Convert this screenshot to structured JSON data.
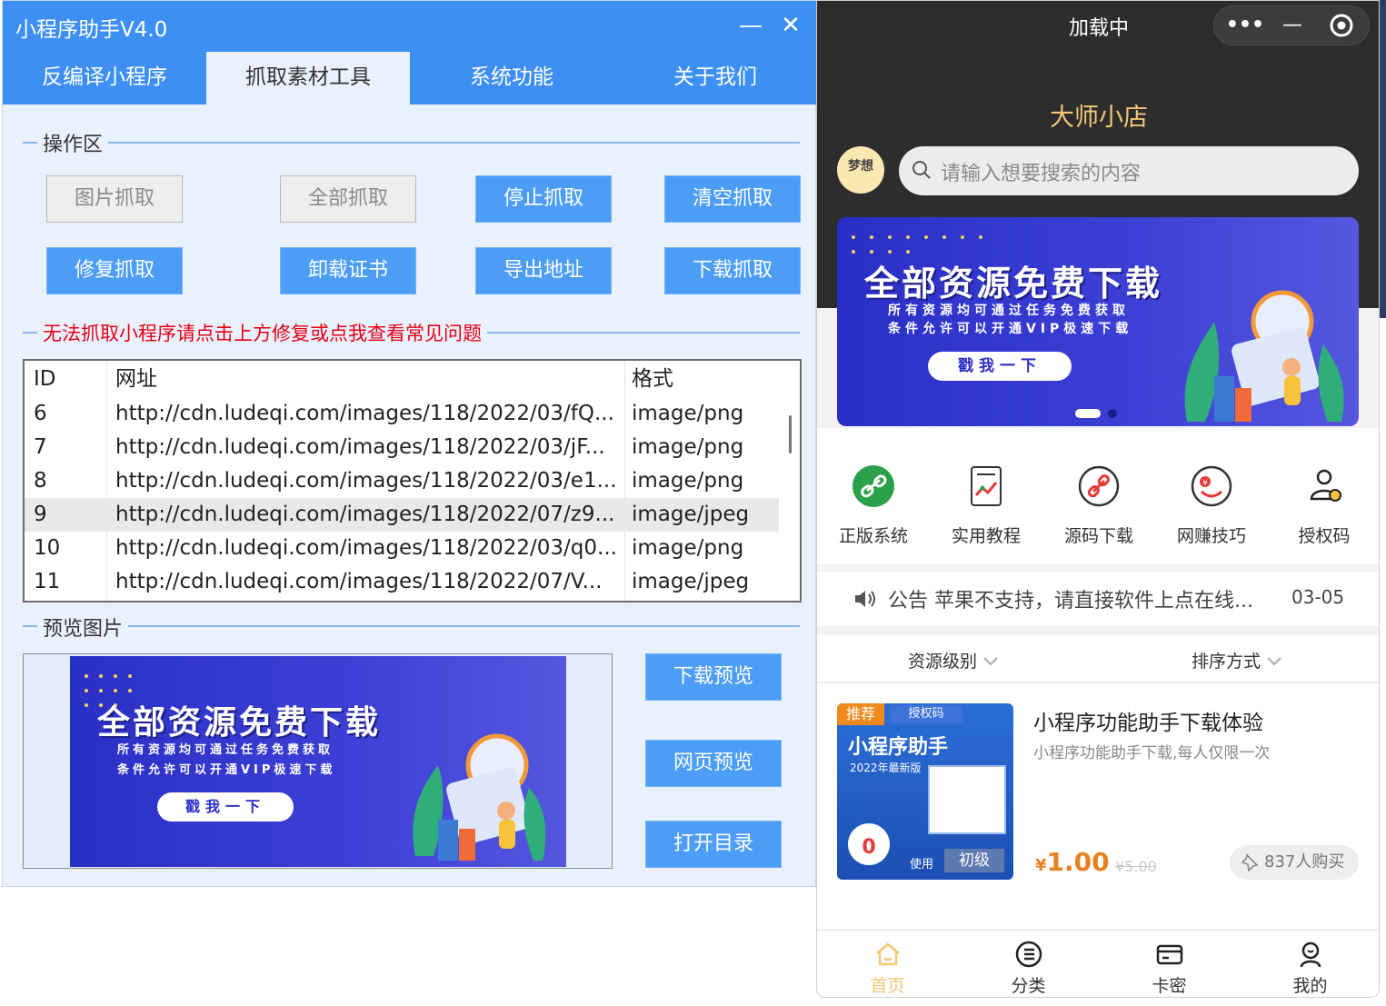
{
  "app": {
    "title": "小程序助手V4.0",
    "min_glyph": "—",
    "close_glyph": "✕",
    "tabs": [
      "反编译小程序",
      "抓取素材工具",
      "系统功能",
      "关于我们"
    ],
    "active_tab": 1
  },
  "ops": {
    "title": "操作区",
    "buttons_row1": [
      "图片抓取",
      "全部抓取",
      "停止抓取",
      "清空抓取"
    ],
    "buttons_row2": [
      "修复抓取",
      "卸载证书",
      "导出地址",
      "下载抓取"
    ],
    "warning": "无法抓取小程序请点击上方修复或点我查看常见问题"
  },
  "table": {
    "headers": [
      "ID",
      "网址",
      "格式"
    ],
    "rows": [
      [
        "6",
        "http://cdn.ludeqi.com/images/118/2022/03/fQ...",
        "image/png"
      ],
      [
        "7",
        "http://cdn.ludeqi.com/images/118/2022/03/jF...",
        "image/png"
      ],
      [
        "8",
        "http://cdn.ludeqi.com/images/118/2022/03/e1...",
        "image/png"
      ],
      [
        "9",
        "http://cdn.ludeqi.com/images/118/2022/07/z9...",
        "image/jpeg"
      ],
      [
        "10",
        "http://cdn.ludeqi.com/images/118/2022/03/q0...",
        "image/png"
      ],
      [
        "11",
        "http://cdn.ludeqi.com/images/118/2022/07/V...",
        "image/jpeg"
      ]
    ],
    "selected_row_id": "9"
  },
  "preview": {
    "title": "预览图片",
    "buttons": [
      "下载预览",
      "网页预览",
      "打开目录"
    ]
  },
  "banner": {
    "title": "全部资源免费下载",
    "line1": "所有资源均可通过任务免费获取",
    "line2": "条件允许可以开通VIP极速下载",
    "cta": "戳我一下"
  },
  "mini": {
    "status": "加载中",
    "capsule_more": "•••",
    "capsule_min": "—",
    "shop_name": "大师小店",
    "logo_text": "梦想",
    "search_placeholder": "请输入想要搜索的内容",
    "grid": [
      {
        "label": "正版系统",
        "icon": "link-icon",
        "color": "#2aa04a"
      },
      {
        "label": "实用教程",
        "icon": "chart-doc-icon",
        "color": "#e53935"
      },
      {
        "label": "源码下载",
        "icon": "link-ring-icon",
        "color": "#e53935"
      },
      {
        "label": "网赚技巧",
        "icon": "money-smile-icon",
        "color": "#e53935"
      },
      {
        "label": "授权码",
        "icon": "users-icon",
        "color": "#222222"
      }
    ],
    "notice_label": "公告",
    "notice_text": "苹果不支持，请直接软件上点在线...",
    "notice_date": "03-05",
    "filters": [
      "资源级别",
      "排序方式"
    ],
    "product": {
      "name": "小程序功能助手下载体验",
      "desc": "小程序功能助手下载,每人仅限一次",
      "currency": "¥",
      "price": "1.00",
      "orig_price": "¥5.00",
      "buyers": "837人购买",
      "tag_recommend": "推荐",
      "tag_auth": "授权码",
      "thumb_title": "小程序助手",
      "thumb_sub": "2022年最新版",
      "thumb_level": "初级",
      "thumb_use": "使用"
    },
    "nav": [
      "首页",
      "分类",
      "卡密",
      "我的"
    ],
    "nav_active": 0
  }
}
